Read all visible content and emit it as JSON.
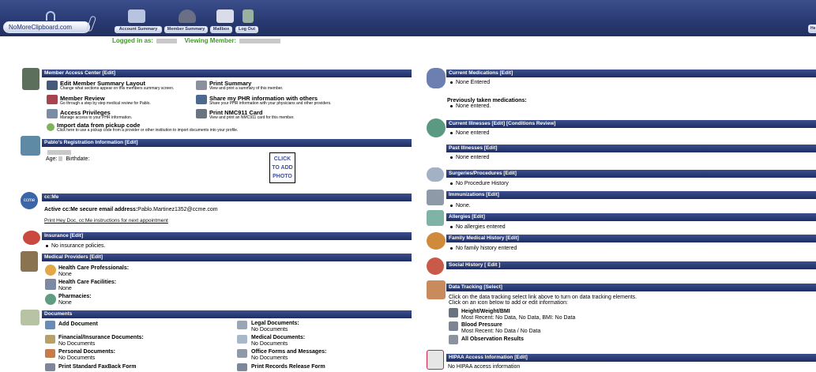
{
  "header": {
    "logo_text": "NoMoreClipboard.com",
    "nav": [
      {
        "label": "Account Summary"
      },
      {
        "label": "Member Summary"
      },
      {
        "label": "Mailbox"
      },
      {
        "label": "Log Out"
      }
    ],
    "logged_in_label": "Logged in as:",
    "viewing_label": "Viewing Member:",
    "help_label": "He"
  },
  "mac": {
    "title": "Member Access Center [Edit]",
    "items": [
      {
        "title": "Edit Member Summary Layout",
        "desc": "Change what sections appear on this members summary screen."
      },
      {
        "title": "Member Review",
        "desc": "Go through a step by step medical review for Pablo."
      },
      {
        "title": "Access Privileges",
        "desc": "Manage access to your PHR information."
      },
      {
        "title": "Print Summary",
        "desc": "View and print a summary of this member."
      },
      {
        "title": "Share my PHR information with others",
        "desc": "Share your PHR information with your physicians and other providers."
      },
      {
        "title": "Print NMC911 Card",
        "desc": "View and print an NMC911 card for this member."
      },
      {
        "title": "Import data from pickup code",
        "desc": "Click here to use a pickup code from a provider or other institution to import documents into your profile."
      }
    ]
  },
  "registration": {
    "title": "Pablo's Registration Information [Edit]",
    "age_label": "Age:",
    "birthdate_label": "Birthdate:",
    "photo_text": [
      "CLICK",
      "TO ADD",
      "PHOTO"
    ]
  },
  "ccme": {
    "title": "cc:Me",
    "icon_text": "ccme",
    "email_label": "Active cc:Me secure email address:",
    "email": "Pablo.Martinez1352@ccme.com",
    "print_link": "Print Hey Doc, cc:Me instructions for next appointment"
  },
  "insurance": {
    "title": "Insurance [Edit]",
    "item": "No insurance policies."
  },
  "providers": {
    "title": "Medical Providers [Edit]",
    "items": [
      {
        "title": "Health Care Professionals:",
        "value": "None"
      },
      {
        "title": "Health Care Facilities:",
        "value": "None"
      },
      {
        "title": "Pharmacies:",
        "value": "None"
      }
    ]
  },
  "documents": {
    "title": "Documents",
    "add": "Add Document",
    "left": [
      {
        "title": "Financial/Insurance Documents:",
        "value": "No Documents"
      },
      {
        "title": "Personal Documents:",
        "value": "No Documents"
      }
    ],
    "right": [
      {
        "title": "Legal Documents:",
        "value": "No Documents"
      },
      {
        "title": "Medical Documents:",
        "value": "No Documents"
      },
      {
        "title": "Office Forms and Messages:",
        "value": "No Documents"
      }
    ],
    "print_fax": "Print Standard FaxBack Form",
    "print_release": "Print Records Release Form"
  },
  "meds": {
    "title": "Current Medications [Edit]",
    "item": "None Entered",
    "prev_label": "Previously taken medications:",
    "prev_item": "None entered."
  },
  "illness": {
    "title": "Current Illnesses [Edit] [Conditions Review]",
    "item": "None entered"
  },
  "past": {
    "title": "Past Illnesses [Edit]",
    "item": "None entered"
  },
  "surgeries": {
    "title": "Surgeries/Procedures [Edit]",
    "item": "No Procedure History"
  },
  "immunizations": {
    "title": "Immunizations [Edit]",
    "item": "None."
  },
  "allergies": {
    "title": "Allergies [Edit]",
    "item": "No allergies entered"
  },
  "family": {
    "title": "Family Medical History [Edit]",
    "item": "No family history entered"
  },
  "social": {
    "title": "Social History [ Edit ]"
  },
  "tracking": {
    "title": "Data Tracking [Select]",
    "line1": "Click on the data tracking select link above to turn on data tracking elements.",
    "line2": "Click on an icon below to add or edit information:",
    "items": [
      {
        "title": "Height/Weight/BMI",
        "value": "Most Recent: No Data, No Data, BMI: No Data"
      },
      {
        "title": "Blood Pressure",
        "value": "Most Recent: No Data / No Data"
      },
      {
        "title": "All Observation Results",
        "value": ""
      }
    ]
  },
  "hipaa": {
    "title": "HIPAA Access Information [Edit]",
    "item": "No HIPAA access information"
  }
}
